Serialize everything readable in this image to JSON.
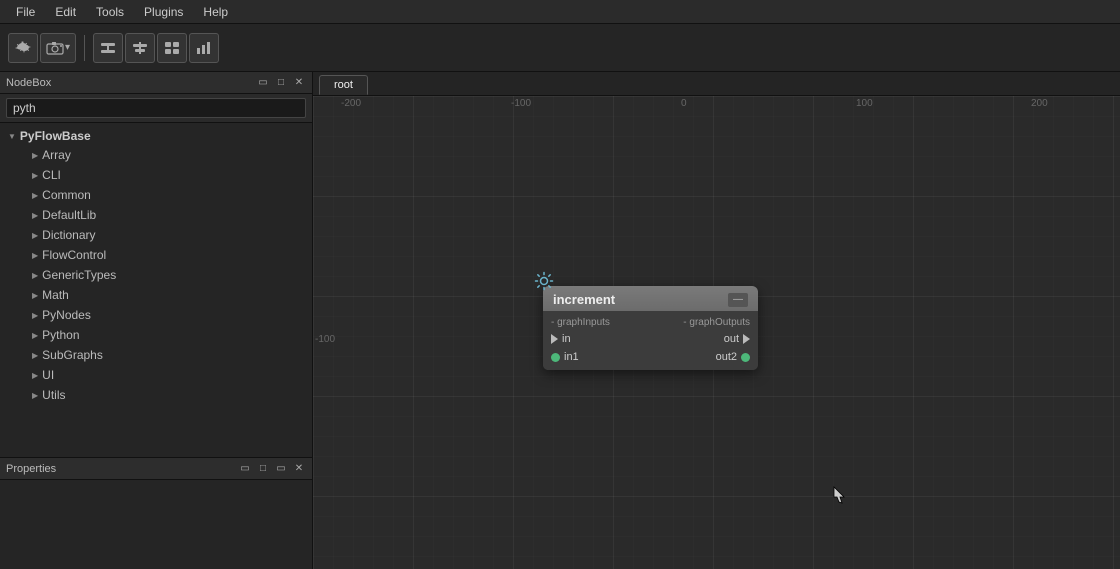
{
  "menubar": {
    "items": [
      "File",
      "Edit",
      "Tools",
      "Plugins",
      "Help"
    ]
  },
  "toolbar": {
    "buttons": [
      "⚙",
      "📷",
      "▾",
      "⬛",
      "⬛",
      "⬛",
      "📊"
    ]
  },
  "nodebox": {
    "title": "NodeBox",
    "search_placeholder": "pyth",
    "tree": {
      "root": "PyFlowBase",
      "children": [
        "Array",
        "CLI",
        "Common",
        "DefaultLib",
        "Dictionary",
        "FlowControl",
        "GenericTypes",
        "Math",
        "PyNodes",
        "Python",
        "SubGraphs",
        "UI",
        "Utils"
      ]
    }
  },
  "properties": {
    "title": "Properties"
  },
  "canvas": {
    "tab": "root",
    "ruler_labels": [
      "-200",
      "-100",
      "0",
      "100",
      "200"
    ],
    "ruler_side_labels": [
      "-100"
    ]
  },
  "node": {
    "title": "increment",
    "section_left": "- graphInputs",
    "section_right": "- graphOutputs",
    "ports": [
      {
        "left_type": "triangle",
        "left_label": "in",
        "right_label": "out",
        "right_type": "triangle"
      },
      {
        "left_type": "circle",
        "left_label": "in1",
        "right_label": "out2",
        "right_type": "circle"
      }
    ]
  }
}
